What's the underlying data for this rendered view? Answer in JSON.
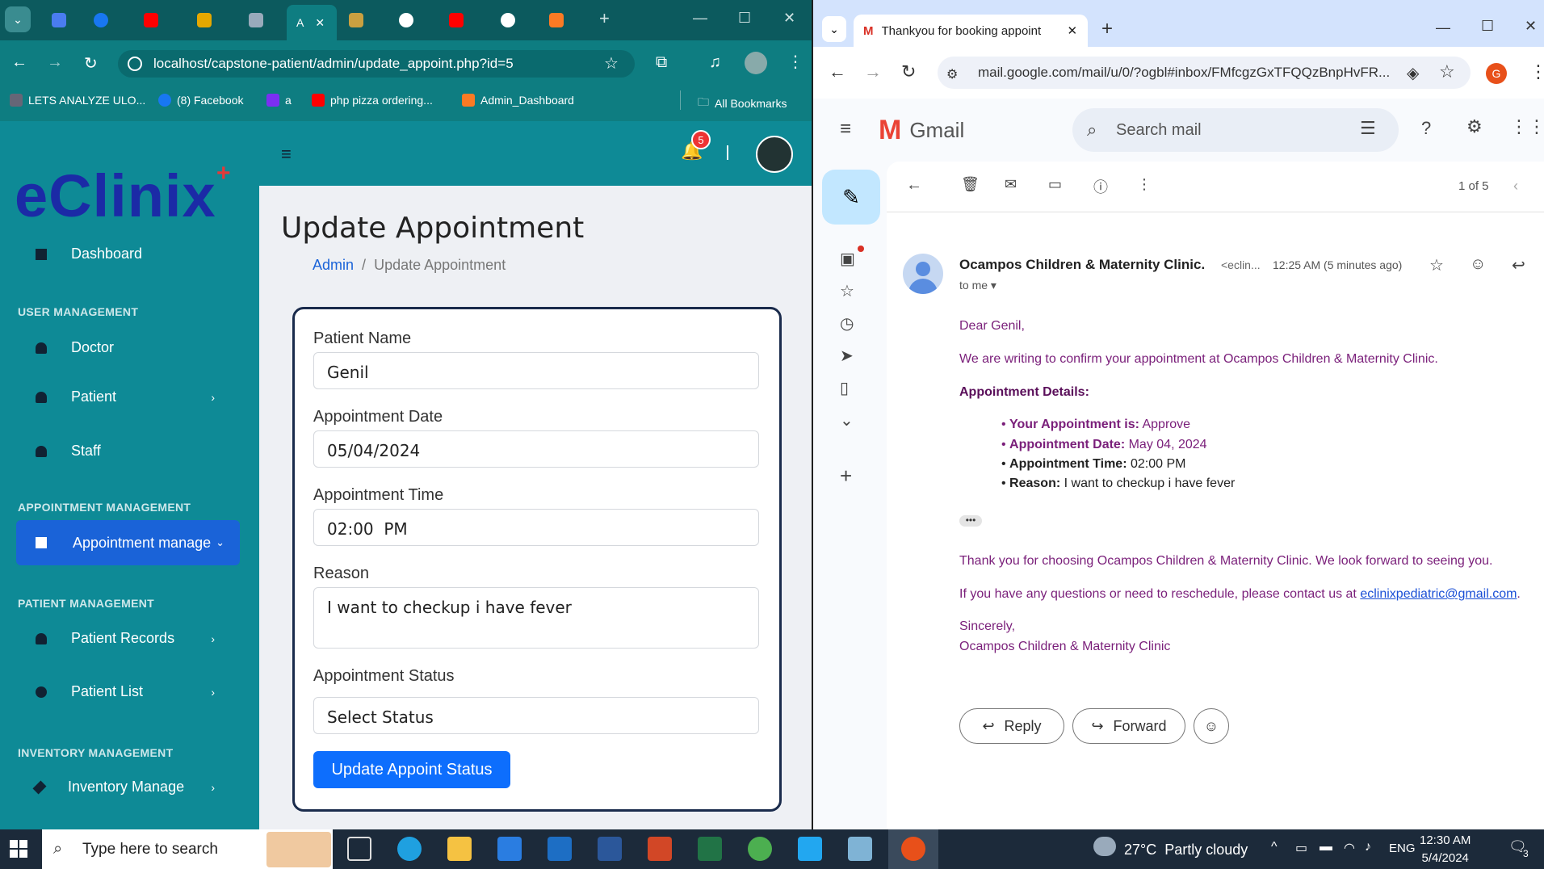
{
  "left_browser": {
    "active_tab_label": "A",
    "address": "localhost/capstone-patient/admin/update_appoint.php?id=5",
    "bookmarks": [
      "LETS ANALYZE ULO...",
      "(8) Facebook",
      "a",
      "php pizza ordering...",
      "Admin_Dashboard"
    ],
    "all_bookmarks": "All Bookmarks"
  },
  "app": {
    "logo": "eClinix",
    "notification_count": "5",
    "sidebar": {
      "dashboard": "Dashboard",
      "sec_user": "USER MANAGEMENT",
      "doctor": "Doctor",
      "patient": "Patient",
      "staff": "Staff",
      "sec_appointment": "APPOINTMENT MANAGEMENT",
      "appointment_manage": "Appointment manage",
      "sec_patient": "PATIENT MANAGEMENT",
      "patient_records": "Patient Records",
      "patient_list": "Patient List",
      "sec_inventory": "INVENTORY MANAGEMENT",
      "inventory_manage": "Inventory Manage"
    },
    "page_title": "Update Appointment",
    "breadcrumb": {
      "root": "Admin",
      "sep": "/",
      "current": "Update Appointment"
    },
    "form": {
      "patient_name_label": "Patient Name",
      "patient_name": "Genil",
      "date_label": "Appointment Date",
      "date": "05/04/2024",
      "time_label": "Appointment Time",
      "time": "02:00  PM",
      "reason_label": "Reason",
      "reason": "I want to checkup i have fever",
      "status_label": "Appointment Status",
      "status": "Select Status",
      "submit": "Update Appoint Status"
    }
  },
  "right_browser": {
    "tab_title": "Thankyou for booking appoint",
    "address": "mail.google.com/mail/u/0/?ogbl#inbox/FMfcgzGxTFQQzBnpHvFR...",
    "profile_initial": "G"
  },
  "gmail": {
    "brand": "Gmail",
    "search_placeholder": "Search mail",
    "pager": "1 of 5",
    "sender": "Ocampos Children & Maternity Clinic.",
    "sender_email": "<eclin...",
    "time": "12:25 AM (5 minutes ago)",
    "to": "to me",
    "greeting": "Dear Genil,",
    "intro": "We are writing to confirm your appointment at Ocampos Children & Maternity Clinic.",
    "details_heading": "Appointment Details:",
    "details": [
      {
        "k": "Your Appointment is:",
        "v": " Approve"
      },
      {
        "k": "Appointment Date:",
        "v": " May 04, 2024"
      },
      {
        "k": "Appointment Time:",
        "v": " 02:00 PM"
      },
      {
        "k": "Reason:",
        "v": " I want to checkup i have fever"
      }
    ],
    "thanks": "Thank you for choosing Ocampos Children & Maternity Clinic. We look forward to seeing you.",
    "contact_prefix": "If you have any questions or need to reschedule, please contact us at ",
    "contact_email": "eclinixpediatric@gmail.com",
    "contact_suffix": ".",
    "sincerely": "Sincerely,",
    "signature": "Ocampos Children & Maternity Clinic",
    "reply": "Reply",
    "forward": "Forward"
  },
  "taskbar": {
    "search_placeholder": "Type here to search",
    "weather": "27°C  Partly cloudy",
    "lang": "ENG",
    "time": "12:30 AM",
    "date": "5/4/2024",
    "notif": "3"
  }
}
